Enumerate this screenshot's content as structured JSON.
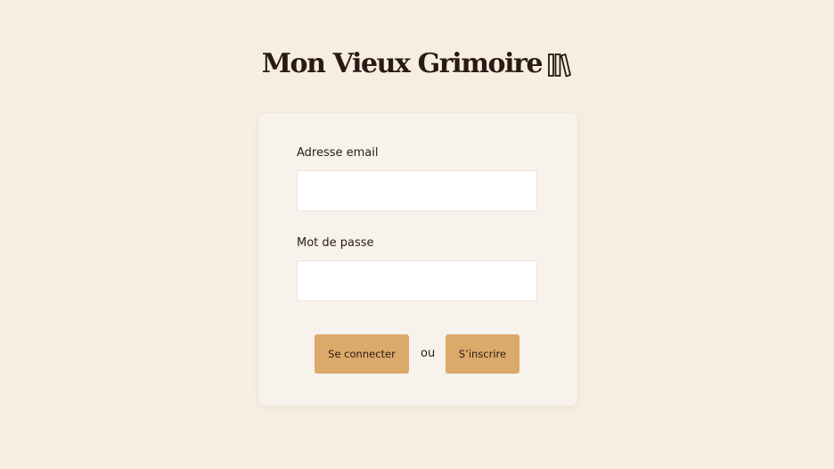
{
  "app": {
    "title": "Mon Vieux Grimoire",
    "logo_icon": "books-icon"
  },
  "colors": {
    "background": "#f7eee2",
    "card": "#f7f2ec",
    "button": "#dba96a",
    "text": "#2b1a14"
  },
  "form": {
    "email_label": "Adresse email",
    "email_value": "",
    "password_label": "Mot de passe",
    "password_value": "",
    "login_label": "Se connecter",
    "separator": "ou",
    "signup_label": "S’inscrire"
  }
}
